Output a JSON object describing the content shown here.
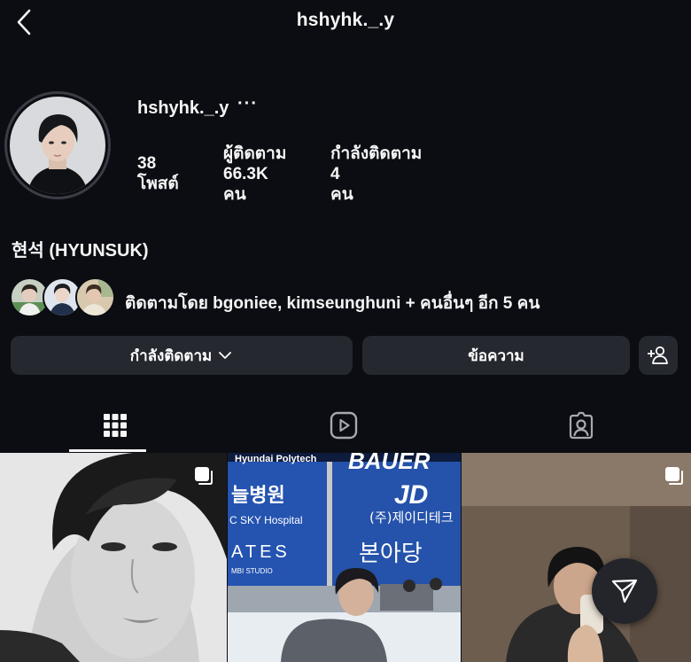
{
  "header": {
    "title": "hshyhk._.y",
    "back_icon": "chevron-left-icon"
  },
  "profile": {
    "username": "hshyhk._.y",
    "more_label": "···",
    "display_name": "현석 (HYUNSUK)",
    "stats": {
      "posts": {
        "value": "38",
        "label": "โพสต์"
      },
      "followers": {
        "label": "ผู้ติดตาม",
        "value": "66.3K",
        "unit": "คน"
      },
      "following": {
        "label": "กำลังติดตาม",
        "value": "4",
        "unit": "คน"
      }
    },
    "mutual_text": "ติดตามโดย bgoniee, kimseunghuni + คนอื่นๆ อีก 5 คน"
  },
  "actions": {
    "following_label": "กำลังติดตาม",
    "message_label": "ข้อความ",
    "add_person_icon": "add-person-icon"
  },
  "tabs": [
    {
      "icon": "grid-icon",
      "active": true
    },
    {
      "icon": "reels-icon",
      "active": false
    },
    {
      "icon": "tagged-icon",
      "active": false
    }
  ],
  "grid": {
    "tile2": {
      "sign_top": "Hyundai Polytech",
      "sign_left_ko": "늘병원",
      "sign_left_en": "C SKY Hospital",
      "sign_brand": "BAUER",
      "sign_jd": "JD",
      "sign_jd_ko": "(주)제이디테크",
      "sign_gates": "ATES",
      "sign_studio": "MBI STUDIO",
      "sign_bonadang": "본아당"
    }
  },
  "colors": {
    "background": "#0b0d12",
    "button": "#25282f",
    "text": "#f5f5f5"
  }
}
